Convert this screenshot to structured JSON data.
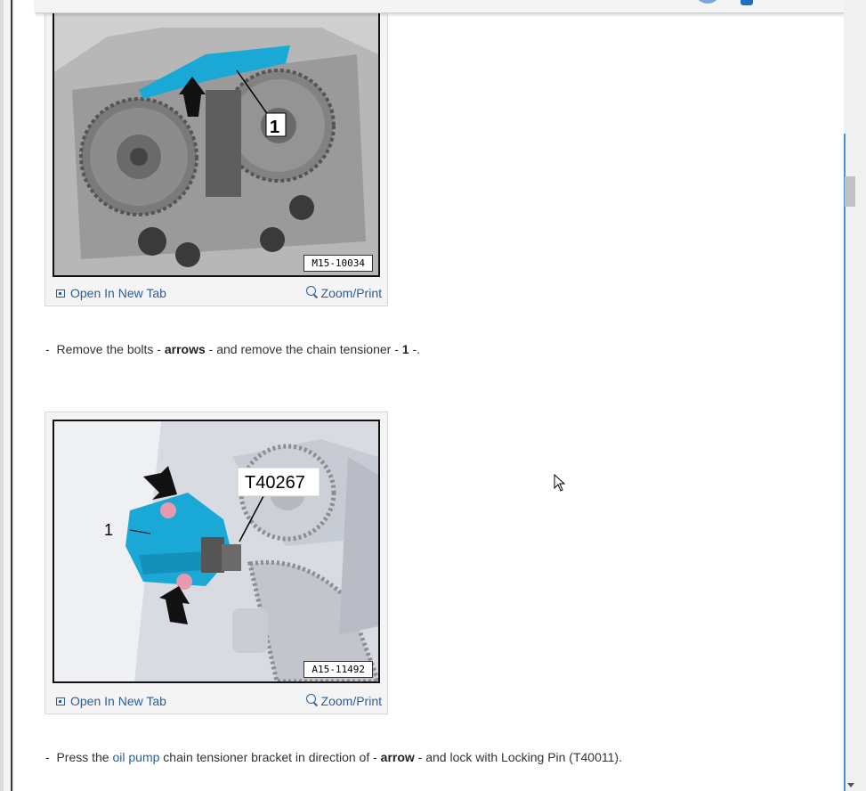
{
  "figures": [
    {
      "code": "M15-10034",
      "callout": "1",
      "open_label": "Open In New Tab",
      "zoom_label": "Zoom/Print"
    },
    {
      "code": "A15-11492",
      "callout": "1",
      "tool_label": "T40267",
      "open_label": "Open In New Tab",
      "zoom_label": "Zoom/Print"
    }
  ],
  "steps": [
    {
      "bullet": "-",
      "t1": "Remove the bolts - ",
      "b1": "arrows",
      "t2": " - and remove the chain tensioner - ",
      "b2": "1",
      "t3": " -."
    },
    {
      "bullet": "-",
      "t1": "Press the ",
      "link": "oil pump",
      "t2": " chain tensioner bracket in direction of - ",
      "b1": "arrow",
      "t3": " - and lock with Locking Pin (T40011)."
    }
  ],
  "colors": {
    "link": "#2a5f9e",
    "tensioner_blue": "#1aa8d6",
    "scroll_accent": "#4a90d9"
  },
  "icons": {
    "open": "open-in-new-tab-icon",
    "zoom": "zoom-icon",
    "cursor": "mouse-pointer-icon"
  }
}
